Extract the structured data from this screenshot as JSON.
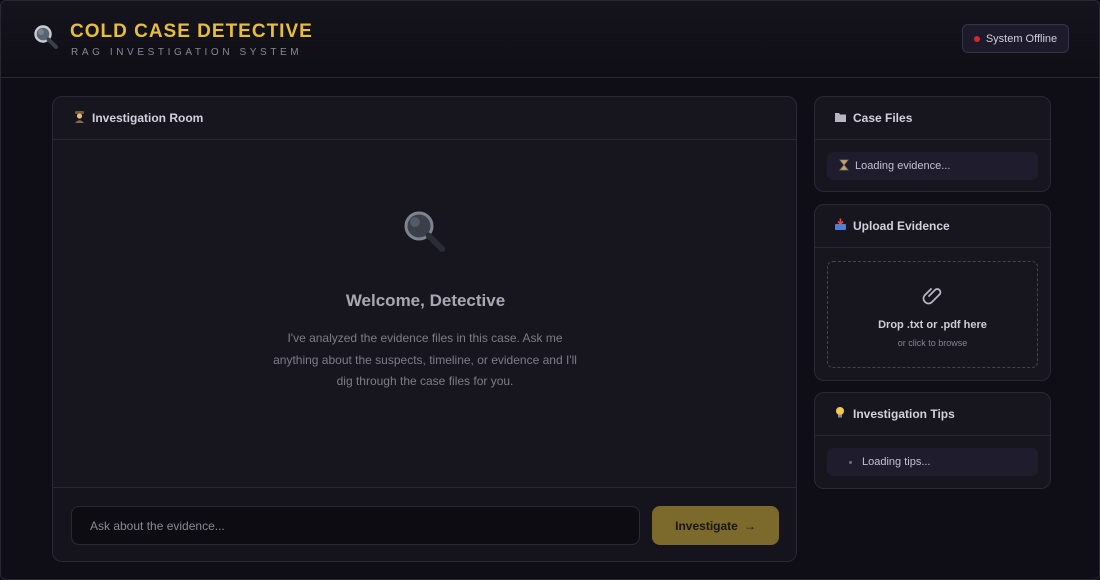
{
  "header": {
    "title": "COLD CASE DETECTIVE",
    "subtitle": "RAG INVESTIGATION SYSTEM",
    "logo_icon": "magnifying-glass-icon",
    "status": {
      "label": "System Offline",
      "color": "#d7262c"
    }
  },
  "chat": {
    "title": "Investigation Room",
    "title_icon": "detective-icon",
    "welcome": {
      "icon": "magnifying-glass-icon",
      "heading": "Welcome, Detective",
      "text": "I've analyzed the evidence files in this case. Ask me anything about the suspects, timeline, or evidence and I'll dig through the case files for you."
    },
    "input_placeholder": "Ask about the evidence...",
    "submit_label": "Investigate",
    "submit_arrow": "→"
  },
  "case_files": {
    "title": "Case Files",
    "title_icon": "folder-icon",
    "loading_icon": "hourglass-icon",
    "loading_text": "Loading evidence..."
  },
  "upload": {
    "title": "Upload Evidence",
    "title_icon": "inbox-tray-icon",
    "drop_icon": "paperclip-icon",
    "drop_title": "Drop .txt or .pdf here",
    "drop_sub": "or click to browse"
  },
  "tips": {
    "title": "Investigation Tips",
    "title_icon": "lightbulb-icon",
    "loading_text": "Loading tips..."
  },
  "colors": {
    "accent_gold": "#e8bd3a",
    "button_gold": "#7b6a2c",
    "background": "#0f0e16",
    "panel": "#17161f"
  }
}
